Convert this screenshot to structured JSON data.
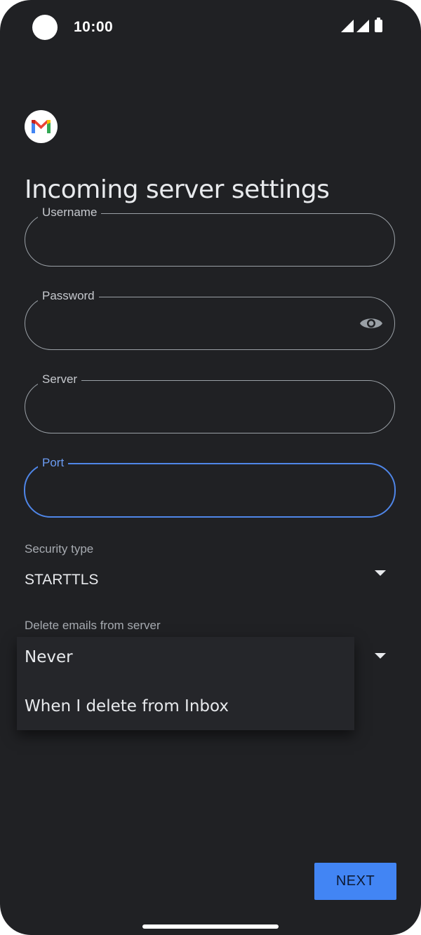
{
  "status_bar": {
    "time": "10:00"
  },
  "page": {
    "title": "Incoming server settings"
  },
  "fields": {
    "username": {
      "label": "Username",
      "value": ""
    },
    "password": {
      "label": "Password",
      "value": ""
    },
    "server": {
      "label": "Server",
      "value": ""
    },
    "port": {
      "label": "Port",
      "value": ""
    }
  },
  "security": {
    "label": "Security type",
    "value": "STARTTLS"
  },
  "delete_emails": {
    "label": "Delete emails from server",
    "options": [
      "Never",
      "When I delete from Inbox"
    ]
  },
  "actions": {
    "next": "NEXT"
  },
  "colors": {
    "background": "#202124",
    "accent": "#4285f4",
    "focus": "#4f86e8"
  }
}
